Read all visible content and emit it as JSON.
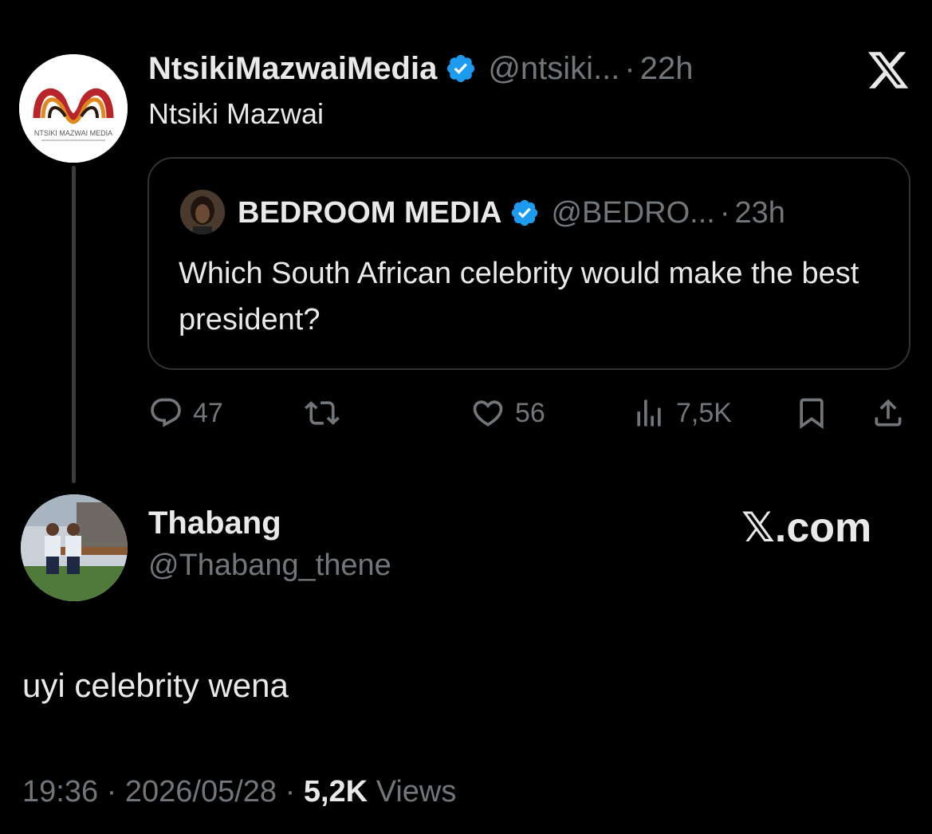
{
  "parent_tweet": {
    "display_name": "NtsikiMazwaiMedia",
    "handle": "@ntsiki...",
    "separator": "·",
    "time": "22h",
    "text": "Ntsiki Mazwai",
    "avatar_logo_text": "NTSIKI MAZWAI MEDIA",
    "quoted": {
      "display_name": "BEDROOM MEDIA",
      "handle": "@BEDRO...",
      "separator": "·",
      "time": "23h",
      "text": "Which South African celebrity would make the best president?"
    },
    "actions": {
      "replies": "47",
      "likes": "56",
      "views": "7,5K"
    }
  },
  "reply_tweet": {
    "display_name": "Thabang",
    "handle": "@Thabang_thene",
    "text": "uyi celebrity wena",
    "time": "19:36",
    "date": "2026/05/28",
    "views_count": "5,2K",
    "views_label": "Views",
    "separator": "·"
  },
  "watermark": "𝕏.com",
  "colors": {
    "background": "#000000",
    "text": "#e7e9ea",
    "muted": "#71767b",
    "verified": "#1d9bf0",
    "border": "#2f3336"
  },
  "icons": [
    "x-logo-icon",
    "verified-badge-icon",
    "reply-icon",
    "retweet-icon",
    "like-icon",
    "views-icon",
    "bookmark-icon",
    "share-icon"
  ]
}
